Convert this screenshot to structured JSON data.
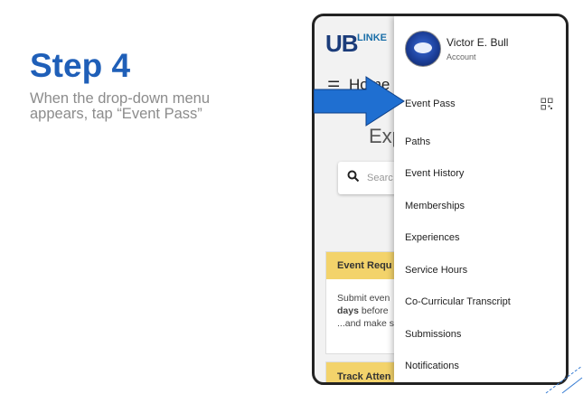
{
  "instruction": {
    "title": "Step 4",
    "description": "When the drop-down menu appears, tap “Event Pass”"
  },
  "app": {
    "logo_main": "UB",
    "logo_sub": "LINKE",
    "header": {
      "home_label": "Home"
    },
    "explore_partial": "Exp",
    "search_placeholder_partial": "Searc",
    "cards": [
      {
        "title": "Event Requ",
        "body_parts": [
          "Submit even",
          "days",
          "before",
          "...and make s"
        ]
      },
      {
        "title": "Track Atten"
      }
    ]
  },
  "menu": {
    "user_name": "Victor E. Bull",
    "user_sub": "Account",
    "items": [
      {
        "label": "Event Pass",
        "icon": "qr-code-icon"
      },
      {
        "label": "Paths"
      },
      {
        "label": "Event History"
      },
      {
        "label": "Memberships"
      },
      {
        "label": "Experiences"
      },
      {
        "label": "Service Hours"
      },
      {
        "label": "Co-Curricular Transcript"
      },
      {
        "label": "Submissions"
      },
      {
        "label": "Notifications"
      }
    ]
  },
  "colors": {
    "title_blue": "#1f5fb8",
    "arrow_blue": "#1f6fd1",
    "card_header_yellow": "#f3d36b"
  }
}
